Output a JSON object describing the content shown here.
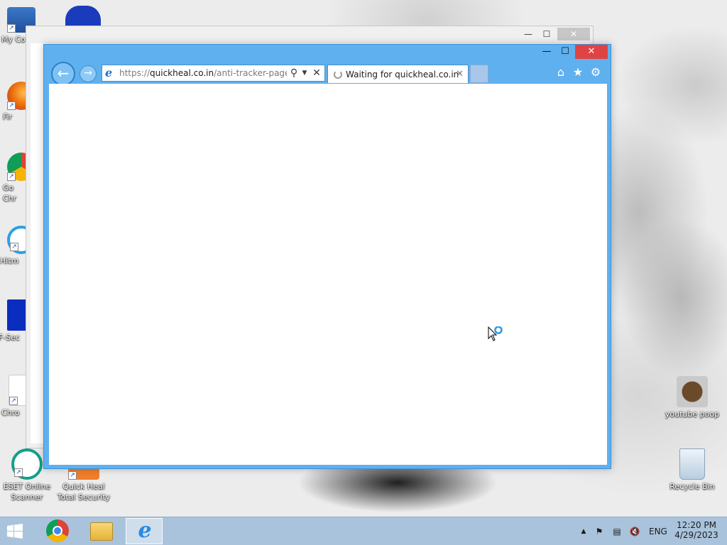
{
  "desktop": {
    "icons": [
      {
        "label": "My Co",
        "id": "my-computer"
      },
      {
        "label": "Fir",
        "id": "firefox"
      },
      {
        "label": "Go Chr",
        "id": "google-chrome"
      },
      {
        "label": "Hitm",
        "id": "hitman"
      },
      {
        "label": "F-Sec",
        "id": "f-secure"
      },
      {
        "label": "Chro",
        "id": "chrome-2"
      },
      {
        "label": "ESET Online Scanner",
        "id": "eset"
      },
      {
        "label": "Quick Heal Total Security",
        "id": "quickheal"
      },
      {
        "label": "youtube poop",
        "id": "youtube-poop"
      },
      {
        "label": "Recycle Bin",
        "id": "recycle-bin"
      }
    ]
  },
  "browser": {
    "url_prefix": "https://",
    "url_host": "quickheal.co.in",
    "url_path": "/anti-tracker-page.htm",
    "tab_title": "Waiting for quickheal.co.in",
    "icons": {
      "back": "back-arrow-icon",
      "forward": "forward-arrow-icon",
      "search": "search-icon",
      "dropdown": "dropdown-icon",
      "stop": "close-icon",
      "home": "home-icon",
      "favorites": "star-icon",
      "tools": "gear-icon"
    }
  },
  "taskbar": {
    "language": "ENG",
    "time": "12:20 PM",
    "date": "4/29/2023"
  },
  "colors": {
    "ie_frame": "#5fb0ef",
    "close_button": "#e04343",
    "taskbar": "#a9c3dc"
  }
}
